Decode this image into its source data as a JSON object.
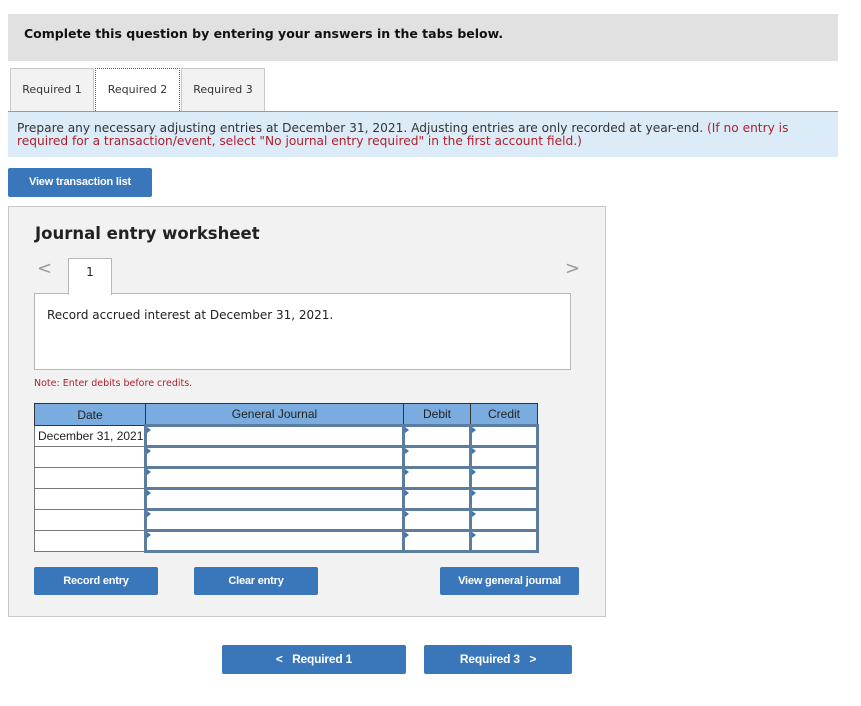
{
  "instruction": "Complete this question by entering your answers in the tabs below.",
  "tabs": [
    {
      "label": "Required 1",
      "active": false
    },
    {
      "label": "Required 2",
      "active": true
    },
    {
      "label": "Required 3",
      "active": false
    }
  ],
  "prompt": {
    "text": "Prepare any necessary adjusting entries at December 31, 2021. Adjusting entries are only recorded at year-end.",
    "note": "(If no entry is required for a transaction/event, select \"No journal entry required\" in the first account field.)"
  },
  "view_transaction_list_label": "View transaction list",
  "worksheet": {
    "title": "Journal entry worksheet",
    "prev_icon": "chevron-left-icon",
    "next_icon": "chevron-right-icon",
    "prev_glyph": "<",
    "next_glyph": ">",
    "current_page": "1",
    "description": "Record accrued interest at December 31, 2021.",
    "note": "Note: Enter debits before credits.",
    "table": {
      "headers": [
        "Date",
        "General Journal",
        "Debit",
        "Credit"
      ],
      "rows": [
        {
          "date": "December 31, 2021",
          "account": "",
          "debit": "",
          "credit": ""
        },
        {
          "date": "",
          "account": "",
          "debit": "",
          "credit": ""
        },
        {
          "date": "",
          "account": "",
          "debit": "",
          "credit": ""
        },
        {
          "date": "",
          "account": "",
          "debit": "",
          "credit": ""
        },
        {
          "date": "",
          "account": "",
          "debit": "",
          "credit": ""
        },
        {
          "date": "",
          "account": "",
          "debit": "",
          "credit": ""
        }
      ]
    },
    "buttons": {
      "record": "Record entry",
      "clear": "Clear entry",
      "view_journal": "View general journal"
    }
  },
  "bottom_nav": {
    "prev_label": "Required 1",
    "next_label": "Required 3",
    "prev_glyph": "<",
    "next_glyph": ">"
  },
  "colors": {
    "button_blue": "#3a76ba",
    "header_blue": "#7aacdf",
    "prompt_bg": "#dcebf8",
    "note_red": "#b0202a"
  }
}
